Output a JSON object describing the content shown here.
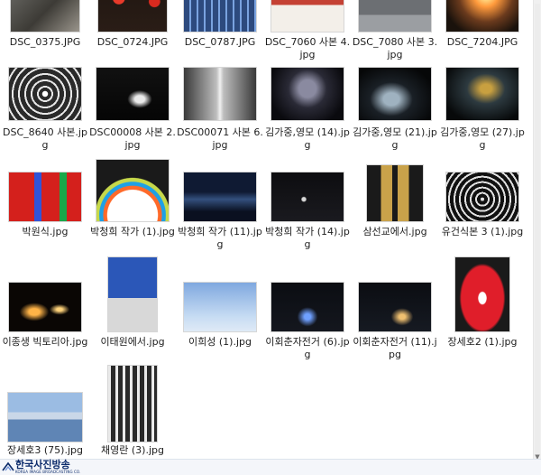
{
  "files": [
    {
      "name": "DSC_0375.JPG",
      "theme": "grey-people"
    },
    {
      "name": "DSC_0724.JPG",
      "theme": "red-balloons"
    },
    {
      "name": "DSC_0787.JPG",
      "theme": "blue-lights"
    },
    {
      "name": "DSC_7060 사본 4.jpg",
      "theme": "red-roofs"
    },
    {
      "name": "DSC_7080 사본 3.jpg",
      "theme": "grey-street"
    },
    {
      "name": "DSC_7204.JPG",
      "theme": "sunset"
    },
    {
      "name": "DSC_8640 사본.jpg",
      "theme": "tunnel-lights"
    },
    {
      "name": "DSC00008 사본 2.jpg",
      "theme": "night-light"
    },
    {
      "name": "DSC00071 사본 6.jpg",
      "theme": "corridor"
    },
    {
      "name": "김가중,영모 (14).jpg",
      "theme": "dark-face"
    },
    {
      "name": "김가중,영모 (21).jpg",
      "theme": "dark-fish"
    },
    {
      "name": "김가중,영모 (27).jpg",
      "theme": "dark-creature"
    },
    {
      "name": "박원식.jpg",
      "theme": "red-gallery"
    },
    {
      "name": "박청희 작가 (1).jpg",
      "theme": "colorful-arch"
    },
    {
      "name": "박청희 작가 (11).jpg",
      "theme": "blue-night"
    },
    {
      "name": "박청희 작가 (14).jpg",
      "theme": "dark-road"
    },
    {
      "name": "삼선교에서.jpg",
      "theme": "stairs-night"
    },
    {
      "name": "유건식본 3 (1).jpg",
      "theme": "spiral"
    },
    {
      "name": "이종생 빅토리아.jpg",
      "theme": "light-swirl"
    },
    {
      "name": "이태원에서.jpg",
      "theme": "blue-sky-bw"
    },
    {
      "name": "이희성 (1).jpg",
      "theme": "jump-sky"
    },
    {
      "name": "이회춘자전거 (6).jpg",
      "theme": "bike-night"
    },
    {
      "name": "이회춘자전거 (11).jpg",
      "theme": "bike-night2"
    },
    {
      "name": "장세호2 (1).jpg",
      "theme": "red-mascot"
    },
    {
      "name": "장세호3 (75).jpg",
      "theme": "harbor"
    },
    {
      "name": "채영란 (3).jpg",
      "theme": "bw-tunnel"
    }
  ],
  "footer": {
    "logo_text": "한국사진방송",
    "logo_sub": "KOREA IMAGE BROADCASTING CO."
  },
  "colors": {
    "caption": "#1e1e1e",
    "logo": "#0b2a6a"
  }
}
